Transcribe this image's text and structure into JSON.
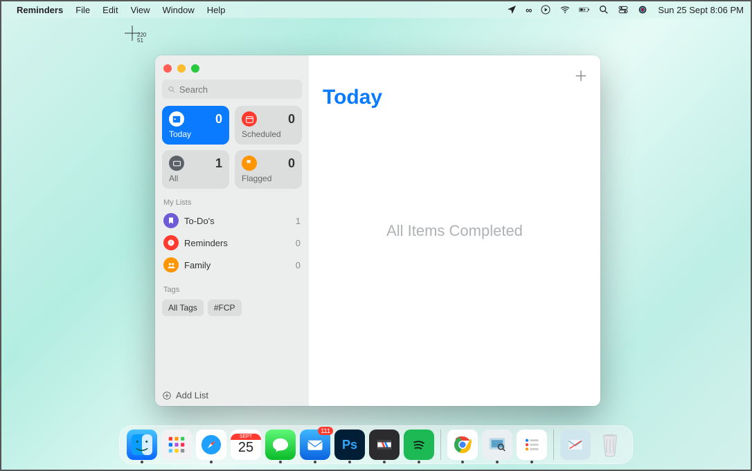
{
  "menubar": {
    "app": "Reminders",
    "items": [
      "File",
      "Edit",
      "View",
      "Window",
      "Help"
    ],
    "datetime": "Sun 25 Sept  8:06 PM"
  },
  "crosshair": {
    "x": "220",
    "y": "51"
  },
  "window": {
    "search": {
      "placeholder": "Search"
    },
    "smart": [
      {
        "key": "today",
        "label": "Today",
        "count": "0",
        "color": "#0a7aff"
      },
      {
        "key": "scheduled",
        "label": "Scheduled",
        "count": "0",
        "color": "#ff3b30"
      },
      {
        "key": "all",
        "label": "All",
        "count": "1",
        "color": "#5b6167"
      },
      {
        "key": "flagged",
        "label": "Flagged",
        "count": "0",
        "color": "#ff9500"
      }
    ],
    "mylists_header": "My Lists",
    "lists": [
      {
        "name": "To-Do's",
        "count": "1",
        "color": "#6e5bd6"
      },
      {
        "name": "Reminders",
        "count": "0",
        "color": "#ff3b30"
      },
      {
        "name": "Family",
        "count": "0",
        "color": "#ff9500"
      }
    ],
    "tags_header": "Tags",
    "tags": [
      "All Tags",
      "#FCP"
    ],
    "add_list_label": "Add List",
    "main_title": "Today",
    "empty_text": "All Items Completed"
  },
  "dock": {
    "apps": [
      {
        "name": "finder",
        "color": "#0aa6ff",
        "running": true
      },
      {
        "name": "launchpad",
        "color": "#eeeeee",
        "running": false
      },
      {
        "name": "safari",
        "color": "#1fa0ff",
        "running": true
      },
      {
        "name": "calendar",
        "color": "#ffffff",
        "running": false,
        "text": "25",
        "label": "SEPT"
      },
      {
        "name": "messages",
        "color": "#34c759",
        "running": true
      },
      {
        "name": "mail",
        "color": "#1f8dff",
        "running": true,
        "badge": "111"
      },
      {
        "name": "photoshop",
        "color": "#001e36",
        "running": true,
        "text": "Ps"
      },
      {
        "name": "final-cut",
        "color": "#2e2e2e",
        "running": true
      },
      {
        "name": "spotify",
        "color": "#1db954",
        "running": true
      }
    ],
    "apps2": [
      {
        "name": "chrome",
        "color": "#ffffff",
        "running": true
      },
      {
        "name": "preview",
        "color": "#6fb9e8",
        "running": true
      },
      {
        "name": "reminders",
        "color": "#ffffff",
        "running": true
      }
    ],
    "apps3": [
      {
        "name": "mail-doc",
        "color": "#cfe6ee",
        "running": false
      },
      {
        "name": "trash",
        "color": "#e5e7e8",
        "running": false
      }
    ]
  }
}
